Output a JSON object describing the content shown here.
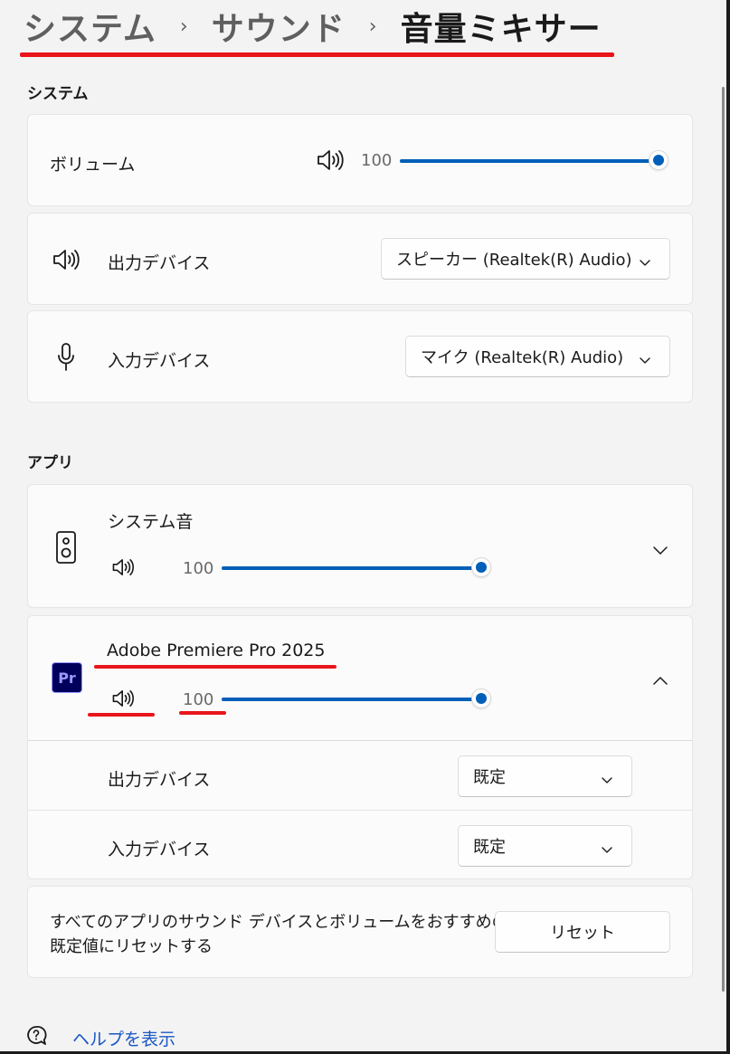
{
  "breadcrumb": {
    "items": [
      "システム",
      "サウンド",
      "音量ミキサー"
    ],
    "separator": "›"
  },
  "system_section": {
    "heading": "システム",
    "volume": {
      "label": "ボリューム",
      "value": "100",
      "level": 1.0
    },
    "output_device": {
      "label": "出力デバイス",
      "selected": "スピーカー (Realtek(R) Audio)"
    },
    "input_device": {
      "label": "入力デバイス",
      "selected": "マイク (Realtek(R) Audio)"
    }
  },
  "apps_section": {
    "heading": "アプリ",
    "apps": [
      {
        "name": "システム音",
        "volume": "100",
        "level": 1.0,
        "expanded": false
      },
      {
        "name": "Adobe Premiere Pro 2025",
        "icon_text": "Pr",
        "volume": "100",
        "level": 1.0,
        "expanded": true,
        "output_label": "出力デバイス",
        "output_value": "既定",
        "input_label": "入力デバイス",
        "input_value": "既定"
      }
    ]
  },
  "reset": {
    "text_line1": "すべてのアプリのサウンド デバイスとボリュームをおすすめの",
    "text_line2": "既定値にリセットする",
    "button": "リセット"
  },
  "help_link": "ヘルプを表示",
  "colors": {
    "accent": "#005fb8",
    "annotation": "#e8151b",
    "background": "#f3f3f3",
    "card": "#fbfbfb"
  }
}
